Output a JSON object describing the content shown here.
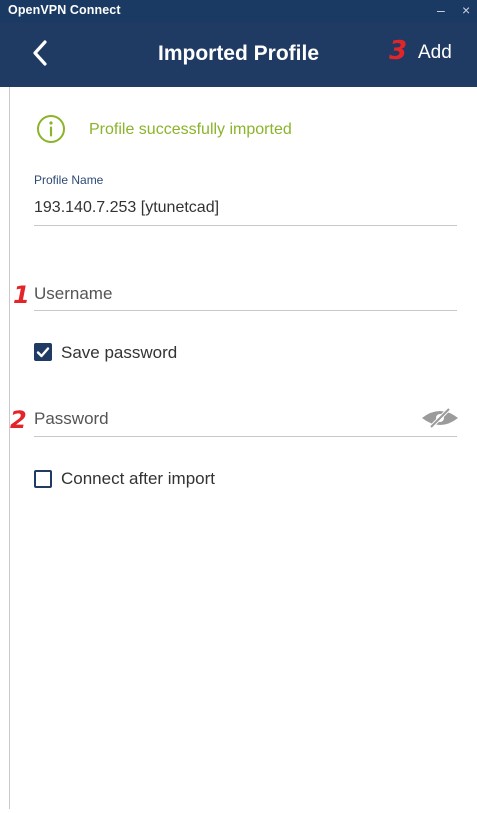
{
  "window": {
    "title": "OpenVPN Connect",
    "minimize": "–",
    "close": "×"
  },
  "header": {
    "title": "Imported Profile",
    "add_label": "Add"
  },
  "success": {
    "message": "Profile successfully imported",
    "icon": "info-icon"
  },
  "profile": {
    "label": "Profile Name",
    "value": "193.140.7.253 [ytunetcad]"
  },
  "username": {
    "placeholder": "Username",
    "value": ""
  },
  "save_password": {
    "label": "Save password",
    "checked": true
  },
  "password": {
    "placeholder": "Password",
    "value": ""
  },
  "connect_after_import": {
    "label": "Connect after import",
    "checked": false
  },
  "annotations": {
    "one": "1",
    "two": "2",
    "three": "3"
  },
  "colors": {
    "header": "#1f3b64",
    "success": "#8ab42a",
    "annotation": "#e3252a"
  }
}
